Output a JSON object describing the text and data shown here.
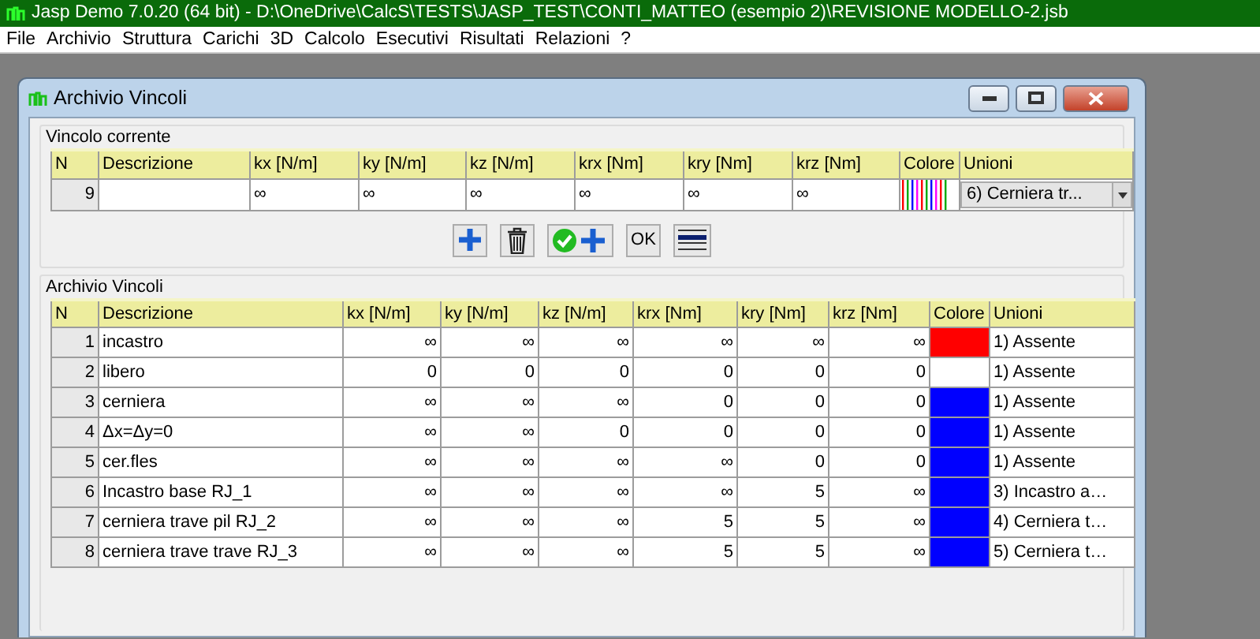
{
  "app_title": "Jasp Demo 7.0.20 (64 bit)  - D:\\OneDrive\\CalcS\\TESTS\\JASP_TEST\\CONTI_MATTEO (esempio 2)\\REVISIONE MODELLO-2.jsb",
  "menu": [
    "File",
    "Archivio",
    "Struttura",
    "Carichi",
    "3D",
    "Calcolo",
    "Esecutivi",
    "Risultati",
    "Relazioni",
    "?"
  ],
  "dialog": {
    "title": "Archivio Vincoli"
  },
  "current": {
    "legend": "Vincolo corrente",
    "columns": [
      "N",
      "Descrizione",
      "kx [N/m]",
      "ky [N/m]",
      "kz [N/m]",
      "krx [Nm]",
      "kry [Nm]",
      "krz [Nm]",
      "Colore",
      "Unioni"
    ],
    "row": {
      "n": "9",
      "values": [
        "∞",
        "∞",
        "∞",
        "∞",
        "∞",
        "∞"
      ],
      "unioni": "6) Cerniera tr..."
    },
    "buttons": [
      {
        "kind": "add"
      },
      {
        "kind": "delete"
      },
      {
        "kind": "save-add"
      },
      {
        "kind": "text",
        "label": "OK"
      },
      {
        "kind": "lines"
      }
    ]
  },
  "archive": {
    "legend": "Archivio Vincoli",
    "columns": [
      "N",
      "Descrizione",
      "kx [N/m]",
      "ky [N/m]",
      "kz [N/m]",
      "krx [Nm]",
      "kry [Nm]",
      "krz [Nm]",
      "Colore",
      "Unioni"
    ],
    "rows": [
      {
        "n": "1",
        "descrizione": "incastro",
        "values": [
          "∞",
          "∞",
          "∞",
          "∞",
          "∞",
          "∞"
        ],
        "color": "#ff0000",
        "unioni": "1) Assente"
      },
      {
        "n": "2",
        "descrizione": "libero",
        "values": [
          "0",
          "0",
          "0",
          "0",
          "0",
          "0"
        ],
        "color": "#ffffff",
        "unioni": "1) Assente"
      },
      {
        "n": "3",
        "descrizione": "cerniera",
        "values": [
          "∞",
          "∞",
          "∞",
          "0",
          "0",
          "0"
        ],
        "color": "#0000ff",
        "unioni": "1) Assente"
      },
      {
        "n": "4",
        "descrizione": "Δx=Δy=0",
        "values": [
          "∞",
          "∞",
          "0",
          "0",
          "0",
          "0"
        ],
        "color": "#0000ff",
        "unioni": "1) Assente"
      },
      {
        "n": "5",
        "descrizione": "cer.fles",
        "values": [
          "∞",
          "∞",
          "∞",
          "∞",
          "0",
          "0"
        ],
        "color": "#0000ff",
        "unioni": "1) Assente"
      },
      {
        "n": "6",
        "descrizione": "Incastro base RJ_1",
        "values": [
          "∞",
          "∞",
          "∞",
          "∞",
          "5",
          "∞"
        ],
        "color": "#0000ff",
        "unioni": "3) Incastro a…"
      },
      {
        "n": "7",
        "descrizione": "cerniera trave pil RJ_2",
        "values": [
          "∞",
          "∞",
          "∞",
          "5",
          "5",
          "∞"
        ],
        "color": "#0000ff",
        "unioni": "4) Cerniera t…"
      },
      {
        "n": "8",
        "descrizione": "cerniera trave trave RJ_3",
        "values": [
          "∞",
          "∞",
          "∞",
          "5",
          "5",
          "∞"
        ],
        "color": "#0000ff",
        "unioni": "5) Cerniera t…"
      }
    ]
  }
}
